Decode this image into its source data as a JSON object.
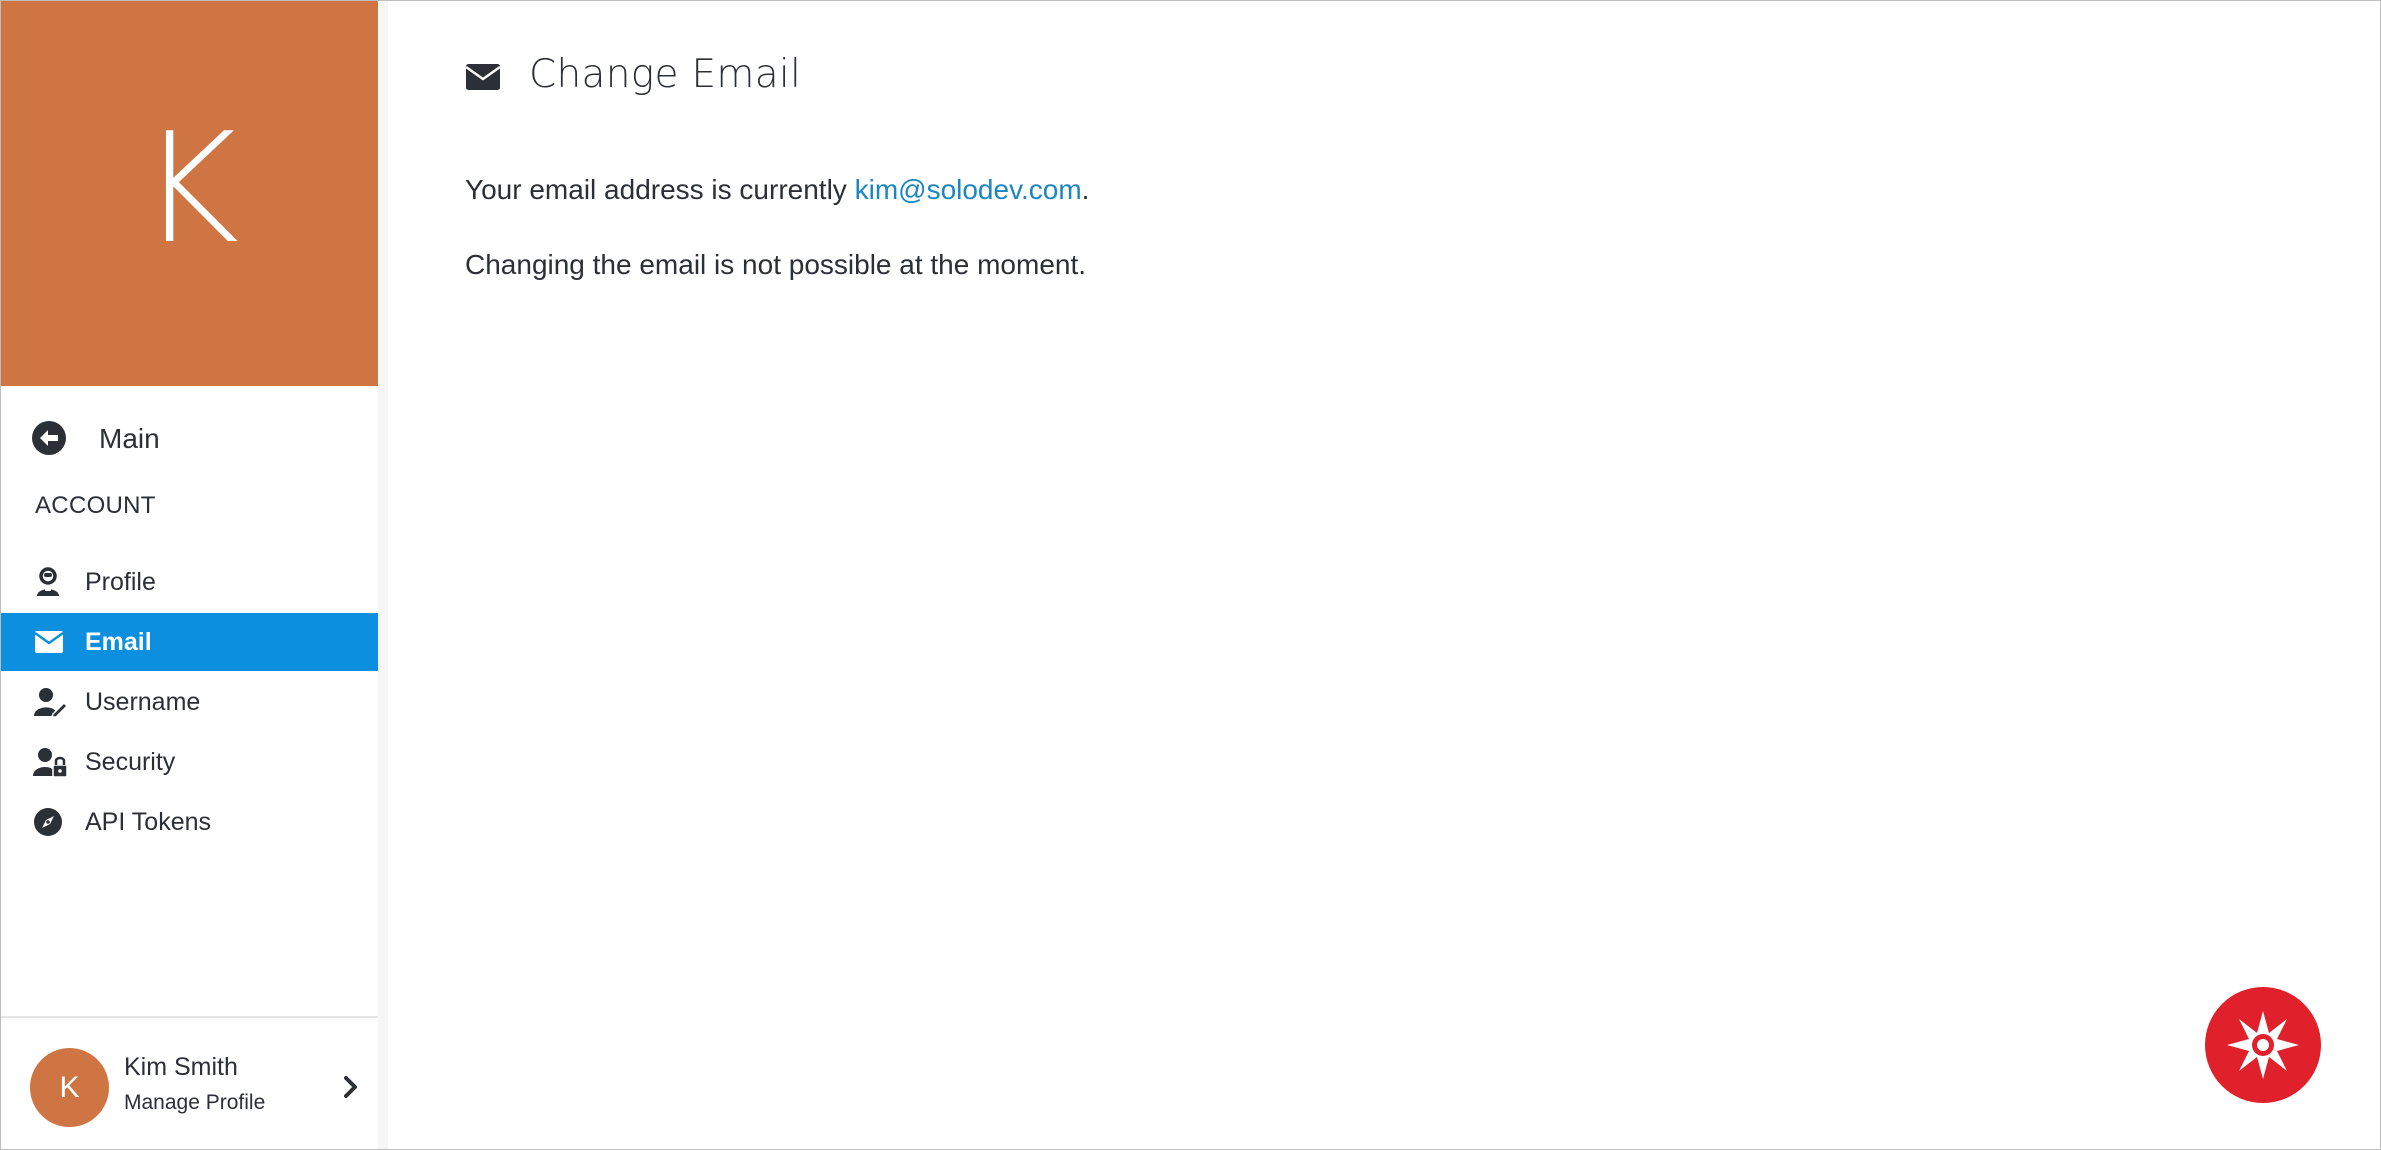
{
  "sidebar": {
    "avatar_letter": "K",
    "main_link": {
      "label": "Main",
      "icon": "arrow-left-circle-icon"
    },
    "section_label": "ACCOUNT",
    "items": [
      {
        "label": "Profile",
        "icon": "user-icon",
        "active": false
      },
      {
        "label": "Email",
        "icon": "envelope-icon",
        "active": true
      },
      {
        "label": "Username",
        "icon": "user-edit-icon",
        "active": false
      },
      {
        "label": "Security",
        "icon": "user-lock-icon",
        "active": false
      },
      {
        "label": "API Tokens",
        "icon": "compass-icon",
        "active": false
      }
    ],
    "footer": {
      "avatar_letter": "K",
      "name": "Kim Smith",
      "sub_label": "Manage Profile",
      "icon": "chevron-right-icon"
    }
  },
  "main": {
    "title": "Change Email",
    "title_icon": "envelope-icon",
    "current_prefix": "Your email address is currently",
    "current_email": "kim@solodev.com",
    "current_suffix": ".",
    "notice": "Changing the email is not possible at the moment."
  },
  "fab": {
    "icon": "star-burst-icon"
  },
  "colors": {
    "avatar": "#cf7544",
    "active_nav": "#0d8fe0",
    "link": "#1a86c4",
    "fab": "#e0202a",
    "text": "#2b2f36"
  }
}
